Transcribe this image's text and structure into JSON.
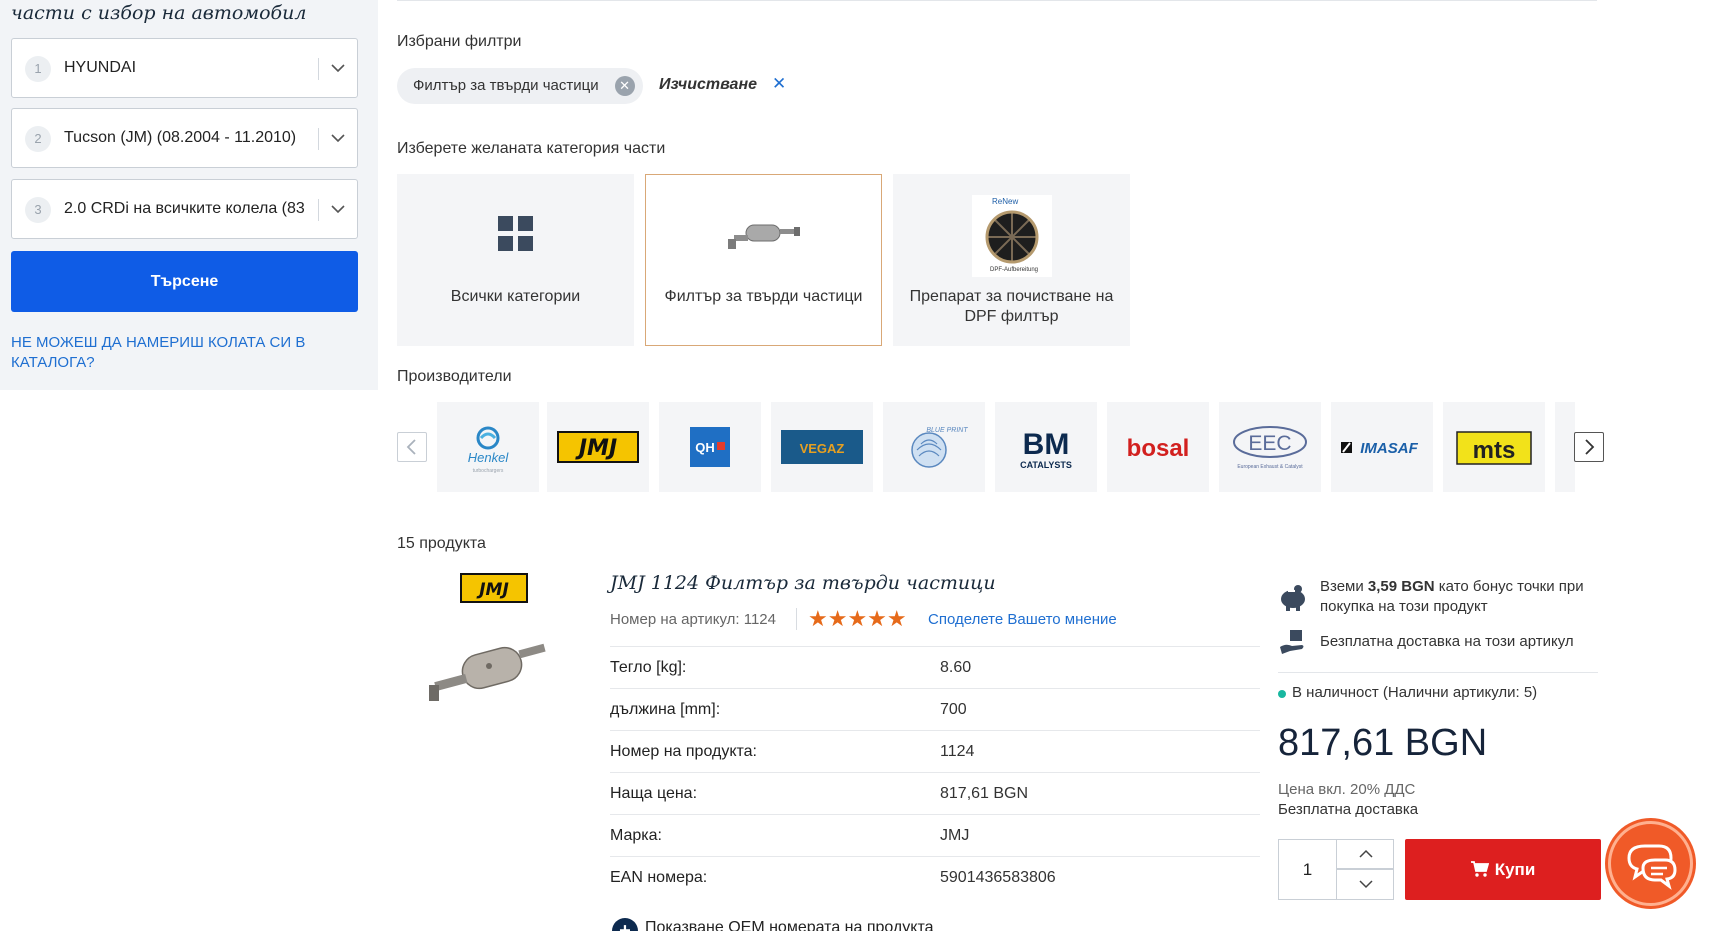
{
  "sidebar": {
    "heading": "части с избор на автомобил",
    "selects": [
      {
        "num": "1",
        "value": "HYUNDAI"
      },
      {
        "num": "2",
        "value": "Tucson (JM) (08.2004 - 11.2010)"
      },
      {
        "num": "3",
        "value": "2.0 CRDi на всичките колела (83"
      }
    ],
    "search_label": "Търсене",
    "cant_find_link": "НЕ МОЖЕШ ДА НАМЕРИШ КОЛАТА СИ В КАТАЛОГА?"
  },
  "filters": {
    "title": "Избрани филтри",
    "active_chip": "Филтър за твърди частици",
    "clear_label": "Изчистване"
  },
  "categories": {
    "title": "Изберете желаната категория части",
    "items": [
      {
        "label": "Всички категории"
      },
      {
        "label": "Филтър за твърди частици"
      },
      {
        "label": "Препарат за почистване на DPF филтър"
      }
    ]
  },
  "manufacturers": {
    "title": "Производители",
    "logos": [
      "Henkel",
      "JMJ",
      "QH",
      "VEGAZ",
      "BLUE PRINT",
      "BM CATALYSTS",
      "bosal",
      "EEC",
      "IMASAF",
      "mts"
    ],
    "logo_subtitles": {
      "eec": "European Exhaust & Catalyst",
      "bm": "CATALYSTS",
      "henkel": "turbochargers"
    }
  },
  "results": {
    "count_label": "15 продукта"
  },
  "product": {
    "brand_logo": "JMJ",
    "title": "JMJ 1124 Филтър за твърди частици",
    "article_no": "Номер на артикул: 1124",
    "rating_stars": 5,
    "stars": "★★★★★",
    "review_link": "Споделете Вашето мнение",
    "specs": [
      {
        "k": "Тегло [kg]:",
        "v": "8.60"
      },
      {
        "k": "дължина [mm]:",
        "v": "700"
      },
      {
        "k": "Номер на продукта:",
        "v": "1124"
      },
      {
        "k": "Наща цена:",
        "v": "817,61 BGN"
      },
      {
        "k": "Марка:",
        "v": "JMJ"
      },
      {
        "k": "EAN номера:",
        "v": "5901436583806"
      }
    ],
    "oem_link": "Показване OEM номерата на продукта"
  },
  "buybox": {
    "bonus_pre": "Вземи ",
    "bonus_amount": "3,59 BGN",
    "bonus_post": " като бонус точки при покупка на този продукт",
    "free_delivery_item": "Безплатна доставка на този артикул",
    "stock": "В наличност (Налични артикули: 5)",
    "price": "817,61 BGN",
    "vat_note": "Цена вкл. 20% ДДС",
    "delivery": "Безплатна доставка",
    "qty": "1",
    "buy_label": "Купи"
  },
  "colors": {
    "primary_blue": "#0f5ce6",
    "link_blue": "#1f6fd1",
    "buy_red": "#dd1f1f",
    "chat_orange": "#f05a28",
    "star_orange": "#e66a1a",
    "stock_green": "#19b7a0",
    "active_border": "#d9a877"
  }
}
